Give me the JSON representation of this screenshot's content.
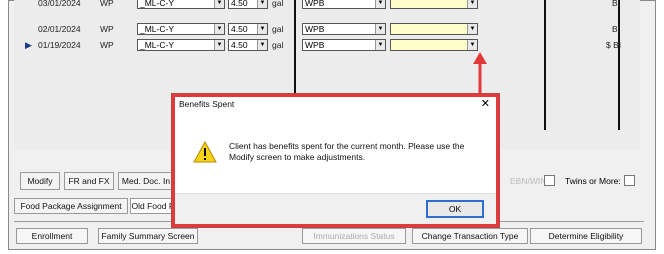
{
  "rows": [
    {
      "date": "03/01/2024",
      "type": "WP",
      "combo1": "_ML-C-Y",
      "qty": "4.50",
      "unit": "gal",
      "combo3": "WPB",
      "flag": "BI"
    },
    {
      "date": "02/01/2024",
      "type": "WP",
      "combo1": "_ML-C-Y",
      "qty": "4.50",
      "unit": "gal",
      "combo3": "WPB",
      "flag": "BI"
    },
    {
      "date": "01/19/2024",
      "type": "WP",
      "combo1": "_ML-C-Y",
      "qty": "4.50",
      "unit": "gal",
      "combo3": "WPB",
      "flag": "$ BI"
    }
  ],
  "toolbar": {
    "modify": "Modify",
    "fr_fx": "FR and FX",
    "med_doc": "Med. Doc. In",
    "wic_label": "EBN/WIN",
    "twins_label": "Twins or More:"
  },
  "tabs": {
    "food_package": "Food Package Assignment",
    "old_food": "Old Food P"
  },
  "bottom": {
    "enrollment": "Enrollment",
    "family_summary": "Family Summary Screen",
    "immunizations": "Immunizations Status",
    "change_transaction": "Change Transaction Type",
    "determine_eligibility": "Determine Eligibility"
  },
  "dialog": {
    "title": "Benefits Spent",
    "close": "✕",
    "message": "Client has benefits spent for the current month. Please use the Modify screen to make adjustments.",
    "ok": "OK"
  },
  "colors": {
    "highlight": "#e23a3a",
    "warning": "#f7d21a",
    "ok_border": "#2a6fd1"
  }
}
